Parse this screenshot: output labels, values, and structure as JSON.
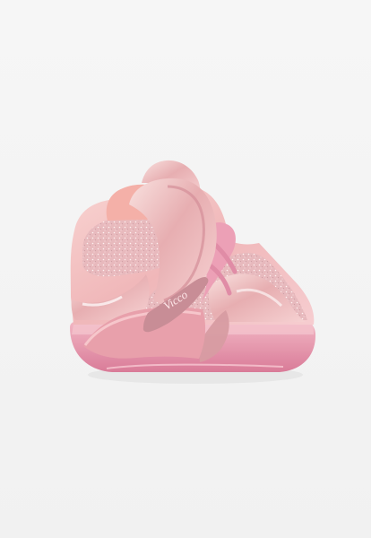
{
  "product": {
    "brand_text": "Vicco",
    "colors": {
      "background": "#f4f4f4",
      "upper": "#f2c3c4",
      "glitter": "#e7b9bd",
      "sole": "#e79aae",
      "lining": "#f2b0a8"
    }
  }
}
